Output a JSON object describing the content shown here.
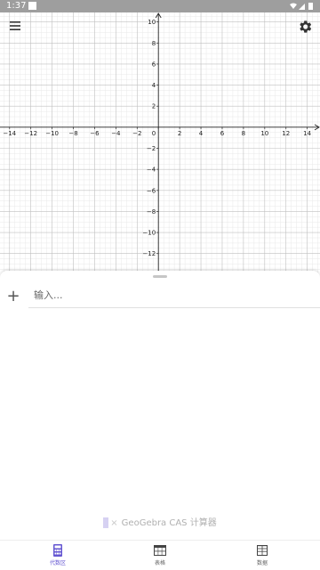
{
  "status_bar": {
    "time": "1:37"
  },
  "graphics": {
    "x_ticks": [
      "−14",
      "−12",
      "−10",
      "−8",
      "−6",
      "−4",
      "−2",
      "0",
      "2",
      "4",
      "6",
      "8",
      "10",
      "12",
      "14"
    ],
    "y_ticks": [
      "10",
      "8",
      "6",
      "4",
      "2",
      "−2",
      "−4",
      "−6",
      "−8",
      "−10",
      "−12"
    ],
    "x_tick_values": [
      -14,
      -12,
      -10,
      -8,
      -6,
      -4,
      -2,
      0,
      2,
      4,
      6,
      8,
      10,
      12,
      14
    ],
    "y_tick_values": [
      10,
      8,
      6,
      4,
      2,
      -2,
      -4,
      -6,
      -8,
      -10,
      -12
    ],
    "x_range": [
      -14.9,
      15.2
    ],
    "y_range": [
      -13.8,
      10.9
    ],
    "grid": true
  },
  "toolbar": {
    "menu_icon": "hamburger-menu-icon",
    "settings_icon": "gear-icon"
  },
  "algebra": {
    "add_icon": "plus-icon",
    "input_placeholder": "输入..."
  },
  "branding": {
    "text": "GeoGebra CAS 计算器"
  },
  "bottom_nav": {
    "items": [
      {
        "label": "代数区",
        "icon": "calculator-icon",
        "active": true
      },
      {
        "label": "表格",
        "icon": "table-icon",
        "active": false
      },
      {
        "label": "数据",
        "icon": "spreadsheet-icon",
        "active": false
      }
    ]
  },
  "colors": {
    "accent": "#6557d2",
    "axis": "#222222",
    "grid_major": "#c0c0c0",
    "grid_minor": "#e8e8e8",
    "status_bar": "#9e9e9e"
  }
}
